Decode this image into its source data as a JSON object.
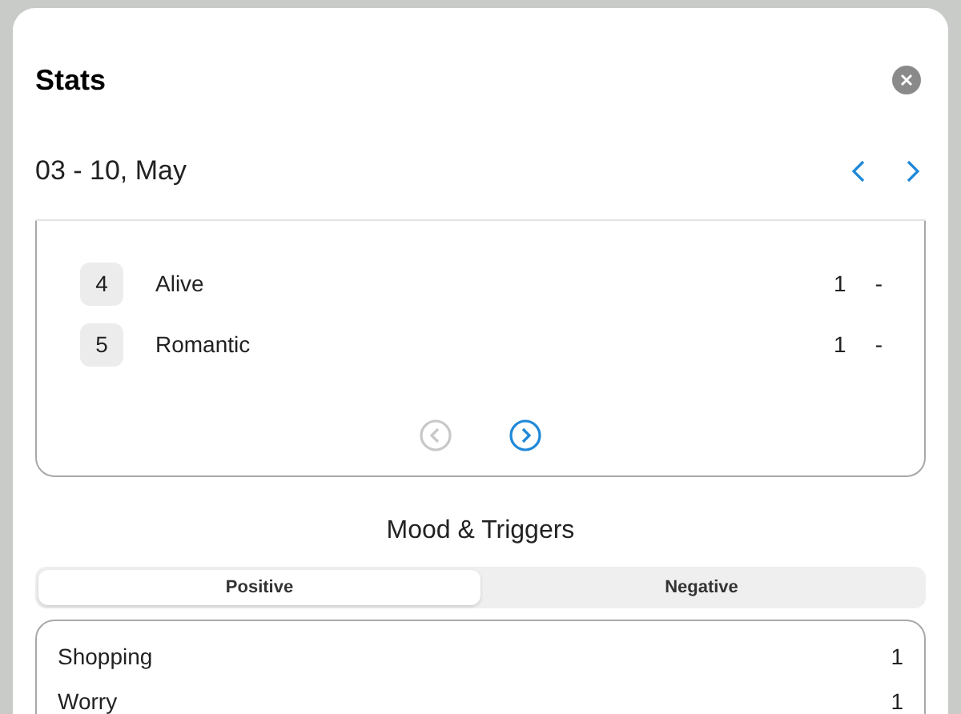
{
  "sheet": {
    "title": "Stats",
    "date_range": "03 - 10, May"
  },
  "ranking": {
    "rows": [
      {
        "rank": "4",
        "name": "Alive",
        "count": "1",
        "change": "-"
      },
      {
        "rank": "5",
        "name": "Romantic",
        "count": "1",
        "change": "-"
      }
    ],
    "pager": {
      "prev_disabled": true,
      "next_disabled": false
    }
  },
  "mood_triggers": {
    "title": "Mood & Triggers",
    "tabs": [
      {
        "label": "Positive",
        "selected": true
      },
      {
        "label": "Negative",
        "selected": false
      }
    ],
    "items": [
      {
        "name": "Shopping",
        "count": "1"
      },
      {
        "name": "Worry",
        "count": "1"
      }
    ]
  }
}
